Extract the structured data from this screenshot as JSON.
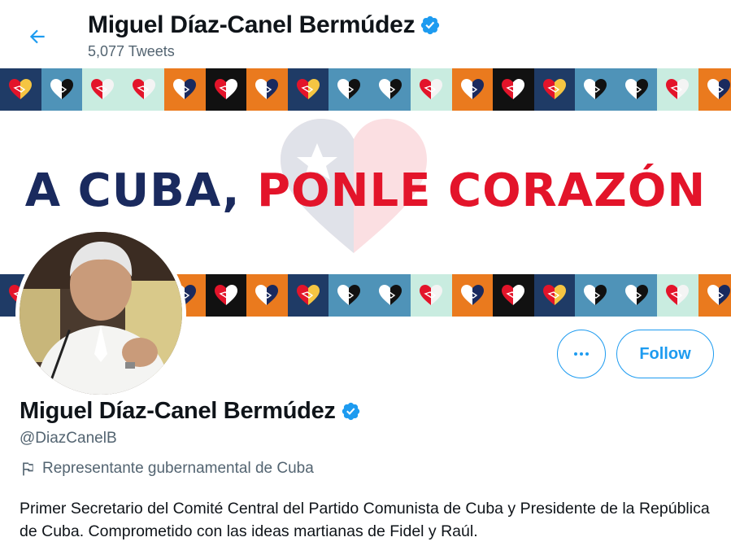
{
  "header": {
    "display_name": "Miguel Díaz-Canel Bermúdez",
    "tweet_count": "5,077 Tweets",
    "back_icon": "arrow-left-icon",
    "verified_icon": "verified-badge-icon"
  },
  "banner": {
    "headline_part1": "A CUBA,",
    "headline_part2": "PONLE CORAZÓN",
    "colors": {
      "navy": "#1a2a5e",
      "red": "#e3142a"
    },
    "tile_icon": "handshake-heart-icon",
    "tiles_top": [
      "navy",
      "teal",
      "mint",
      "mint",
      "orange",
      "black",
      "orange",
      "navy",
      "teal",
      "teal",
      "mint",
      "orange",
      "black",
      "navy",
      "teal",
      "teal",
      "mint",
      "orange",
      "navy"
    ],
    "tiles_bottom": [
      "navy",
      "teal",
      "mint",
      "mint",
      "orange",
      "black",
      "orange",
      "navy",
      "teal",
      "teal",
      "mint",
      "orange",
      "black",
      "navy",
      "teal",
      "teal",
      "mint",
      "orange",
      "navy"
    ]
  },
  "actions": {
    "more_icon": "more-horizontal-icon",
    "follow_label": "Follow"
  },
  "profile": {
    "display_name": "Miguel Díaz-Canel Bermúdez",
    "handle": "@DiazCanelB",
    "category": "Representante gubernamental de Cuba",
    "category_icon": "flag-icon",
    "bio": "Primer Secretario del Comité Central del Partido Comunista de Cuba y Presidente de la República de Cuba. Comprometido con las ideas martianas de Fidel y Raúl."
  },
  "theme": {
    "accent": "#1d9bf0",
    "secondary_text": "#536471"
  }
}
